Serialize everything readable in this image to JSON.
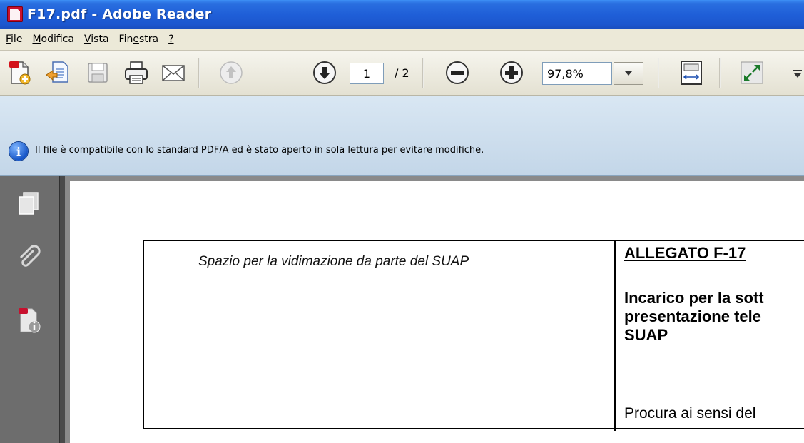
{
  "window": {
    "title": "F17.pdf - Adobe Reader"
  },
  "menu": {
    "items": [
      {
        "label": "File",
        "mnemonic": "F",
        "rest": "ile"
      },
      {
        "label": "Modifica",
        "mnemonic": "M",
        "rest": "odifica"
      },
      {
        "label": "Vista",
        "mnemonic": "V",
        "rest": "ista"
      },
      {
        "label": "Finestra",
        "pre": "Fin",
        "mnemonic": "e",
        "rest": "stra"
      },
      {
        "label": "?",
        "mnemonic": "?",
        "rest": ""
      }
    ]
  },
  "toolbar": {
    "page_current": "1",
    "page_total": "/ 2",
    "zoom": "97,8%",
    "icons": [
      "create-pdf-icon",
      "open-icon",
      "save-icon",
      "print-icon",
      "email-icon",
      "previous-page-icon",
      "next-page-icon",
      "zoom-out-icon",
      "zoom-in-icon",
      "fit-page-icon",
      "full-screen-icon",
      "more-tools-icon"
    ]
  },
  "infobar": {
    "message": "Il file è compatibile con lo standard PDF/A ed è stato aperto in sola lettura per evitare modifiche."
  },
  "navpanel": {
    "icons": [
      "pages-icon",
      "attachments-icon",
      "document-info-icon"
    ]
  },
  "document": {
    "stamp_label": "Spazio per la vidimazione da parte del SUAP",
    "allegato": "ALLEGATO F-17",
    "incarico_line1": "Incarico per la sott",
    "incarico_line2": "presentazione tele",
    "incarico_line3": "SUAP",
    "procura": "Procura ai sensi del"
  },
  "colors": {
    "titlebar": "#1f5fd8",
    "infobar": "#cfdfee",
    "navpanel": "#6d6d6d",
    "doc_background": "#8a8a8a"
  }
}
